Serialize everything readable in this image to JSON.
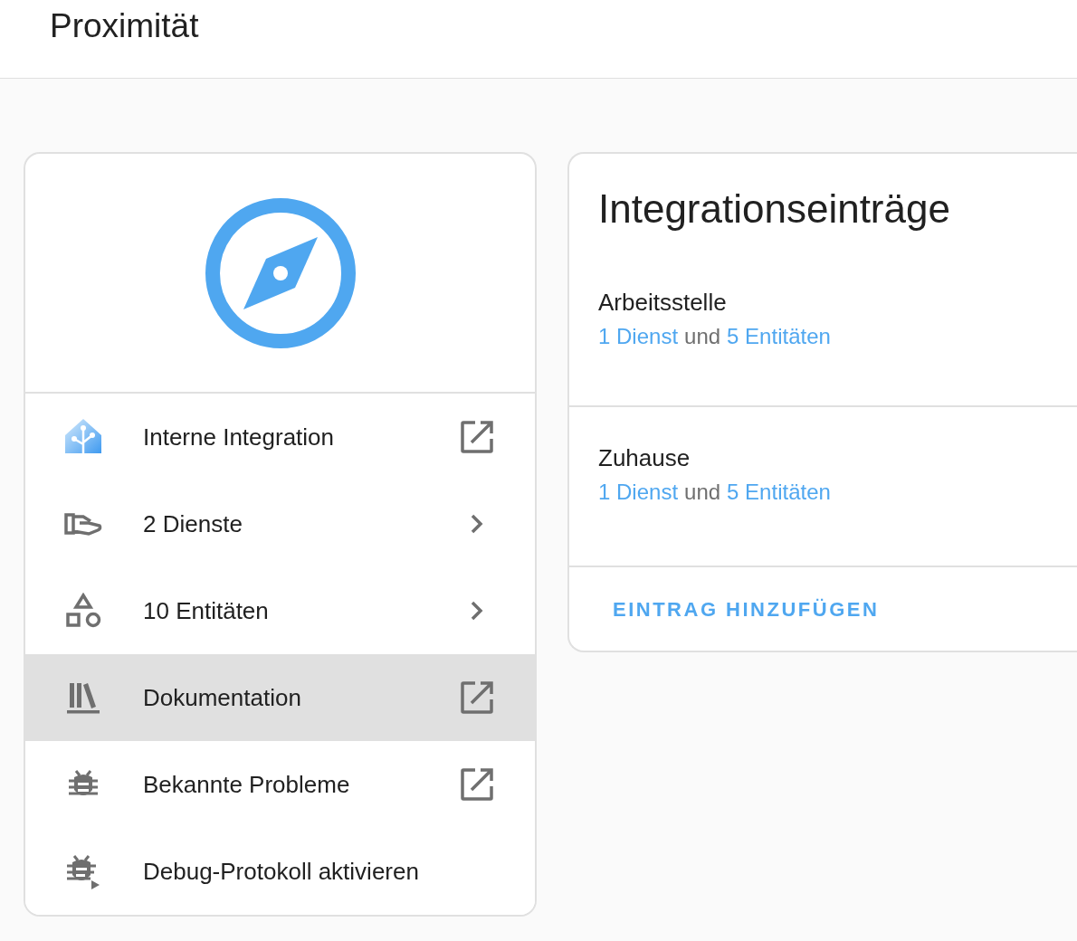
{
  "header": {
    "title": "Proximität"
  },
  "info_card": {
    "items": [
      {
        "kind": "link",
        "label": "Interne Integration",
        "selected": false
      },
      {
        "kind": "submenu",
        "label": "2 Dienste",
        "selected": false
      },
      {
        "kind": "submenu",
        "label": "10 Entitäten",
        "selected": false
      },
      {
        "kind": "link",
        "label": "Dokumentation",
        "selected": true
      },
      {
        "kind": "link",
        "label": "Bekannte Probleme",
        "selected": false
      },
      {
        "kind": "action",
        "label": "Debug-Protokoll aktivieren",
        "selected": false
      }
    ]
  },
  "entries_card": {
    "title": "Integrationseinträge",
    "entries": [
      {
        "name": "Arbeitsstelle",
        "services": "1 Dienst",
        "joiner": "und",
        "entities": "5 Entitäten"
      },
      {
        "name": "Zuhause",
        "services": "1 Dienst",
        "joiner": "und",
        "entities": "5 Entitäten"
      }
    ],
    "add_button": "EINTRAG HINZUFÜGEN"
  }
}
